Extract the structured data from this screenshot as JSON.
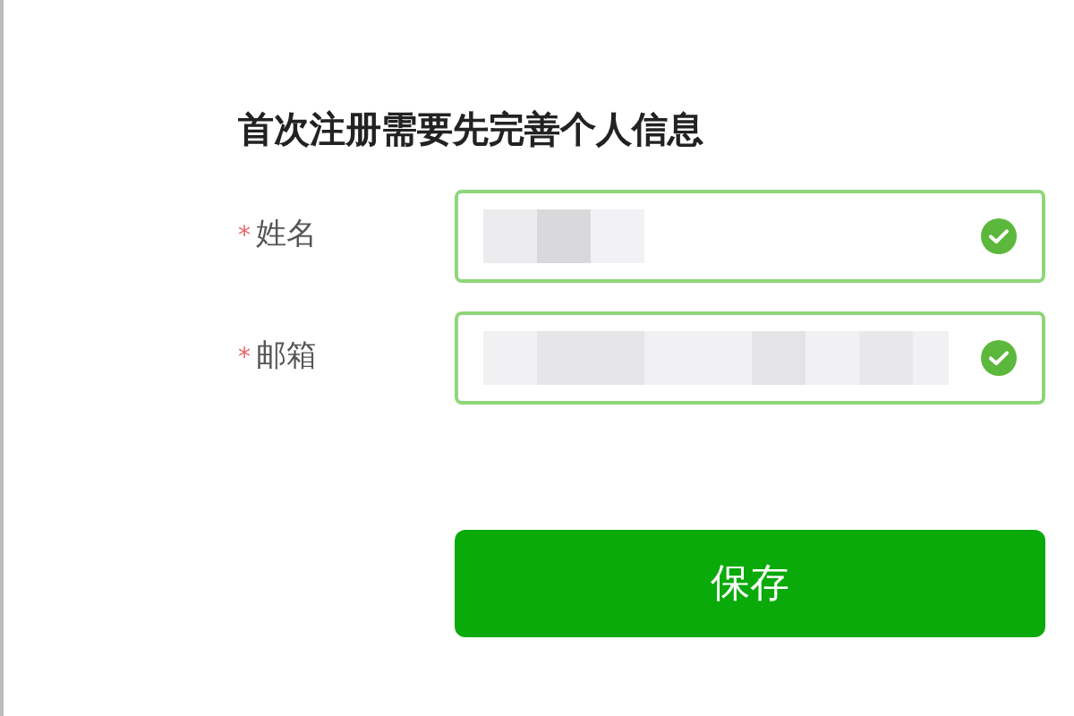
{
  "title": "首次注册需要先完善个人信息",
  "fields": [
    {
      "label": "姓名",
      "required_mark": "*",
      "valid": true
    },
    {
      "label": "邮箱",
      "required_mark": "*",
      "valid": true
    }
  ],
  "save_button": "保存"
}
